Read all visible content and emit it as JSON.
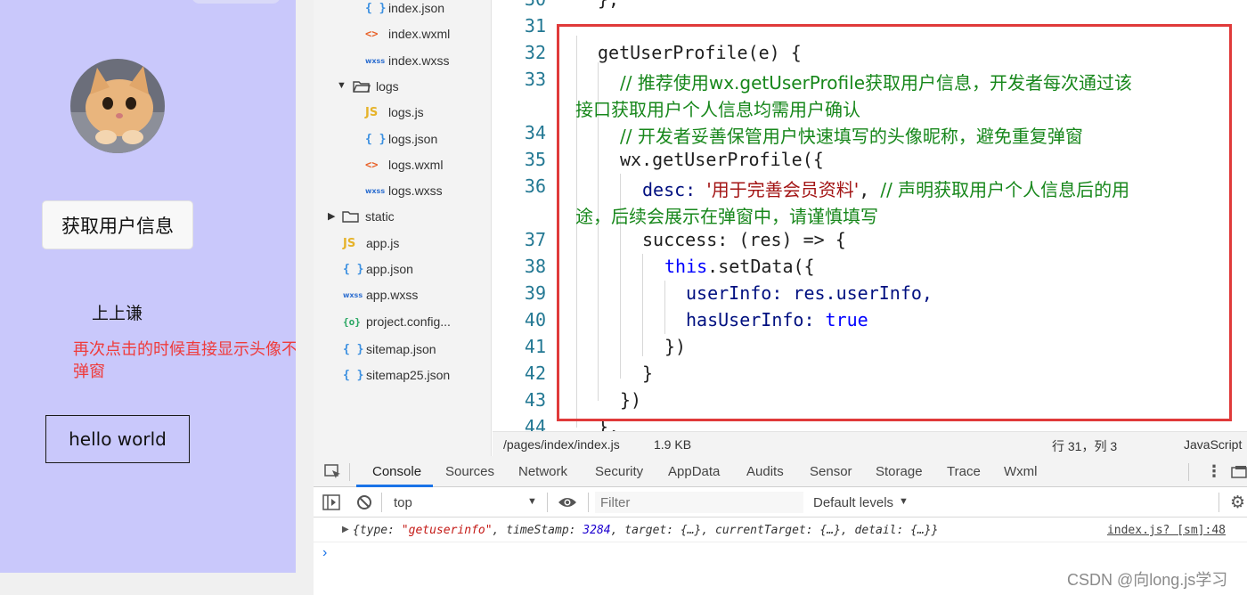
{
  "simulator": {
    "get_profile_button": "获取用户信息",
    "nickname": "上上谦",
    "note": "再次点击的时候直接显示头像不弹窗",
    "hello_button": "hello world"
  },
  "file_tree": {
    "items": [
      {
        "label": "index.json",
        "icon": "json-icon"
      },
      {
        "label": "index.wxml",
        "icon": "wxml-icon"
      },
      {
        "label": "index.wxss",
        "icon": "wxss-icon"
      },
      {
        "label": "logs",
        "icon": "folder-open-icon"
      },
      {
        "label": "logs.js",
        "icon": "js-icon"
      },
      {
        "label": "logs.json",
        "icon": "json-icon"
      },
      {
        "label": "logs.wxml",
        "icon": "wxml-icon"
      },
      {
        "label": "logs.wxss",
        "icon": "wxss-icon"
      },
      {
        "label": "static",
        "icon": "folder-icon"
      },
      {
        "label": "app.js",
        "icon": "js-icon"
      },
      {
        "label": "app.json",
        "icon": "json-icon"
      },
      {
        "label": "app.wxss",
        "icon": "wxss-icon"
      },
      {
        "label": "project.config...",
        "icon": "config-icon"
      },
      {
        "label": "sitemap.json",
        "icon": "json-icon"
      },
      {
        "label": "sitemap25.json",
        "icon": "json-icon"
      }
    ],
    "icon_text": {
      "json": "{ }",
      "wxml": "<>",
      "wxss": "wxss",
      "js": "JS",
      "config": "{o}"
    }
  },
  "editor": {
    "line_numbers": [
      "30",
      "31",
      "32",
      "33",
      "34",
      "35",
      "36",
      "37",
      "38",
      "39",
      "40",
      "41",
      "42",
      "43",
      "44"
    ],
    "lines": {
      "l30": "},",
      "l32": "getUserProfile(e) {",
      "l33a": "// 推荐使用wx.getUserProfile获取用户信息，开发者每次通过该",
      "l33b": "接口获取用户个人信息均需用户确认",
      "l34": "// 开发者妥善保管用户快速填写的头像昵称，避免重复弹窗",
      "l35": "wx.getUserProfile({",
      "l36_key": "desc: ",
      "l36_str": "'用于完善会员资料'",
      "l36_comma": ", ",
      "l36_cmt": "// 声明获取用户个人信息后的用",
      "l36b": "途，后续会展示在弹窗中，请谨慎填写",
      "l37": "success: (res) => {",
      "l38_kw": "this",
      "l38_rest": ".setData({",
      "l39": "userInfo: res.userInfo,",
      "l40_key": "hasUserInfo: ",
      "l40_val": "true",
      "l41": "})",
      "l42": "}",
      "l43": "})",
      "l44": "},"
    }
  },
  "status_bar": {
    "path": "/pages/index/index.js",
    "size": "1.9 KB",
    "position": "行 31，列 3",
    "language": "JavaScript"
  },
  "devtools": {
    "tabs": [
      "Console",
      "Sources",
      "Network",
      "Security",
      "AppData",
      "Audits",
      "Sensor",
      "Storage",
      "Trace",
      "Wxml"
    ],
    "context": "top",
    "filter_placeholder": "Filter",
    "levels": "Default levels",
    "log": {
      "p1": "{type: ",
      "type_val": "\"getuserinfo\"",
      "p2": ", timeStamp: ",
      "ts": "3284",
      "p3": ", target: {…}, currentTarget: {…}, detail: {…}}",
      "source": "index.js? [sm]:48"
    }
  },
  "watermark": "CSDN @向long.js学习",
  "colors": {
    "simulator_bg": "#c9c8fb",
    "highlight_border": "#e03a3a",
    "note_red": "#ef3b3b",
    "comment": "#17871b",
    "keyword": "#0000ff",
    "string": "#a31515"
  }
}
